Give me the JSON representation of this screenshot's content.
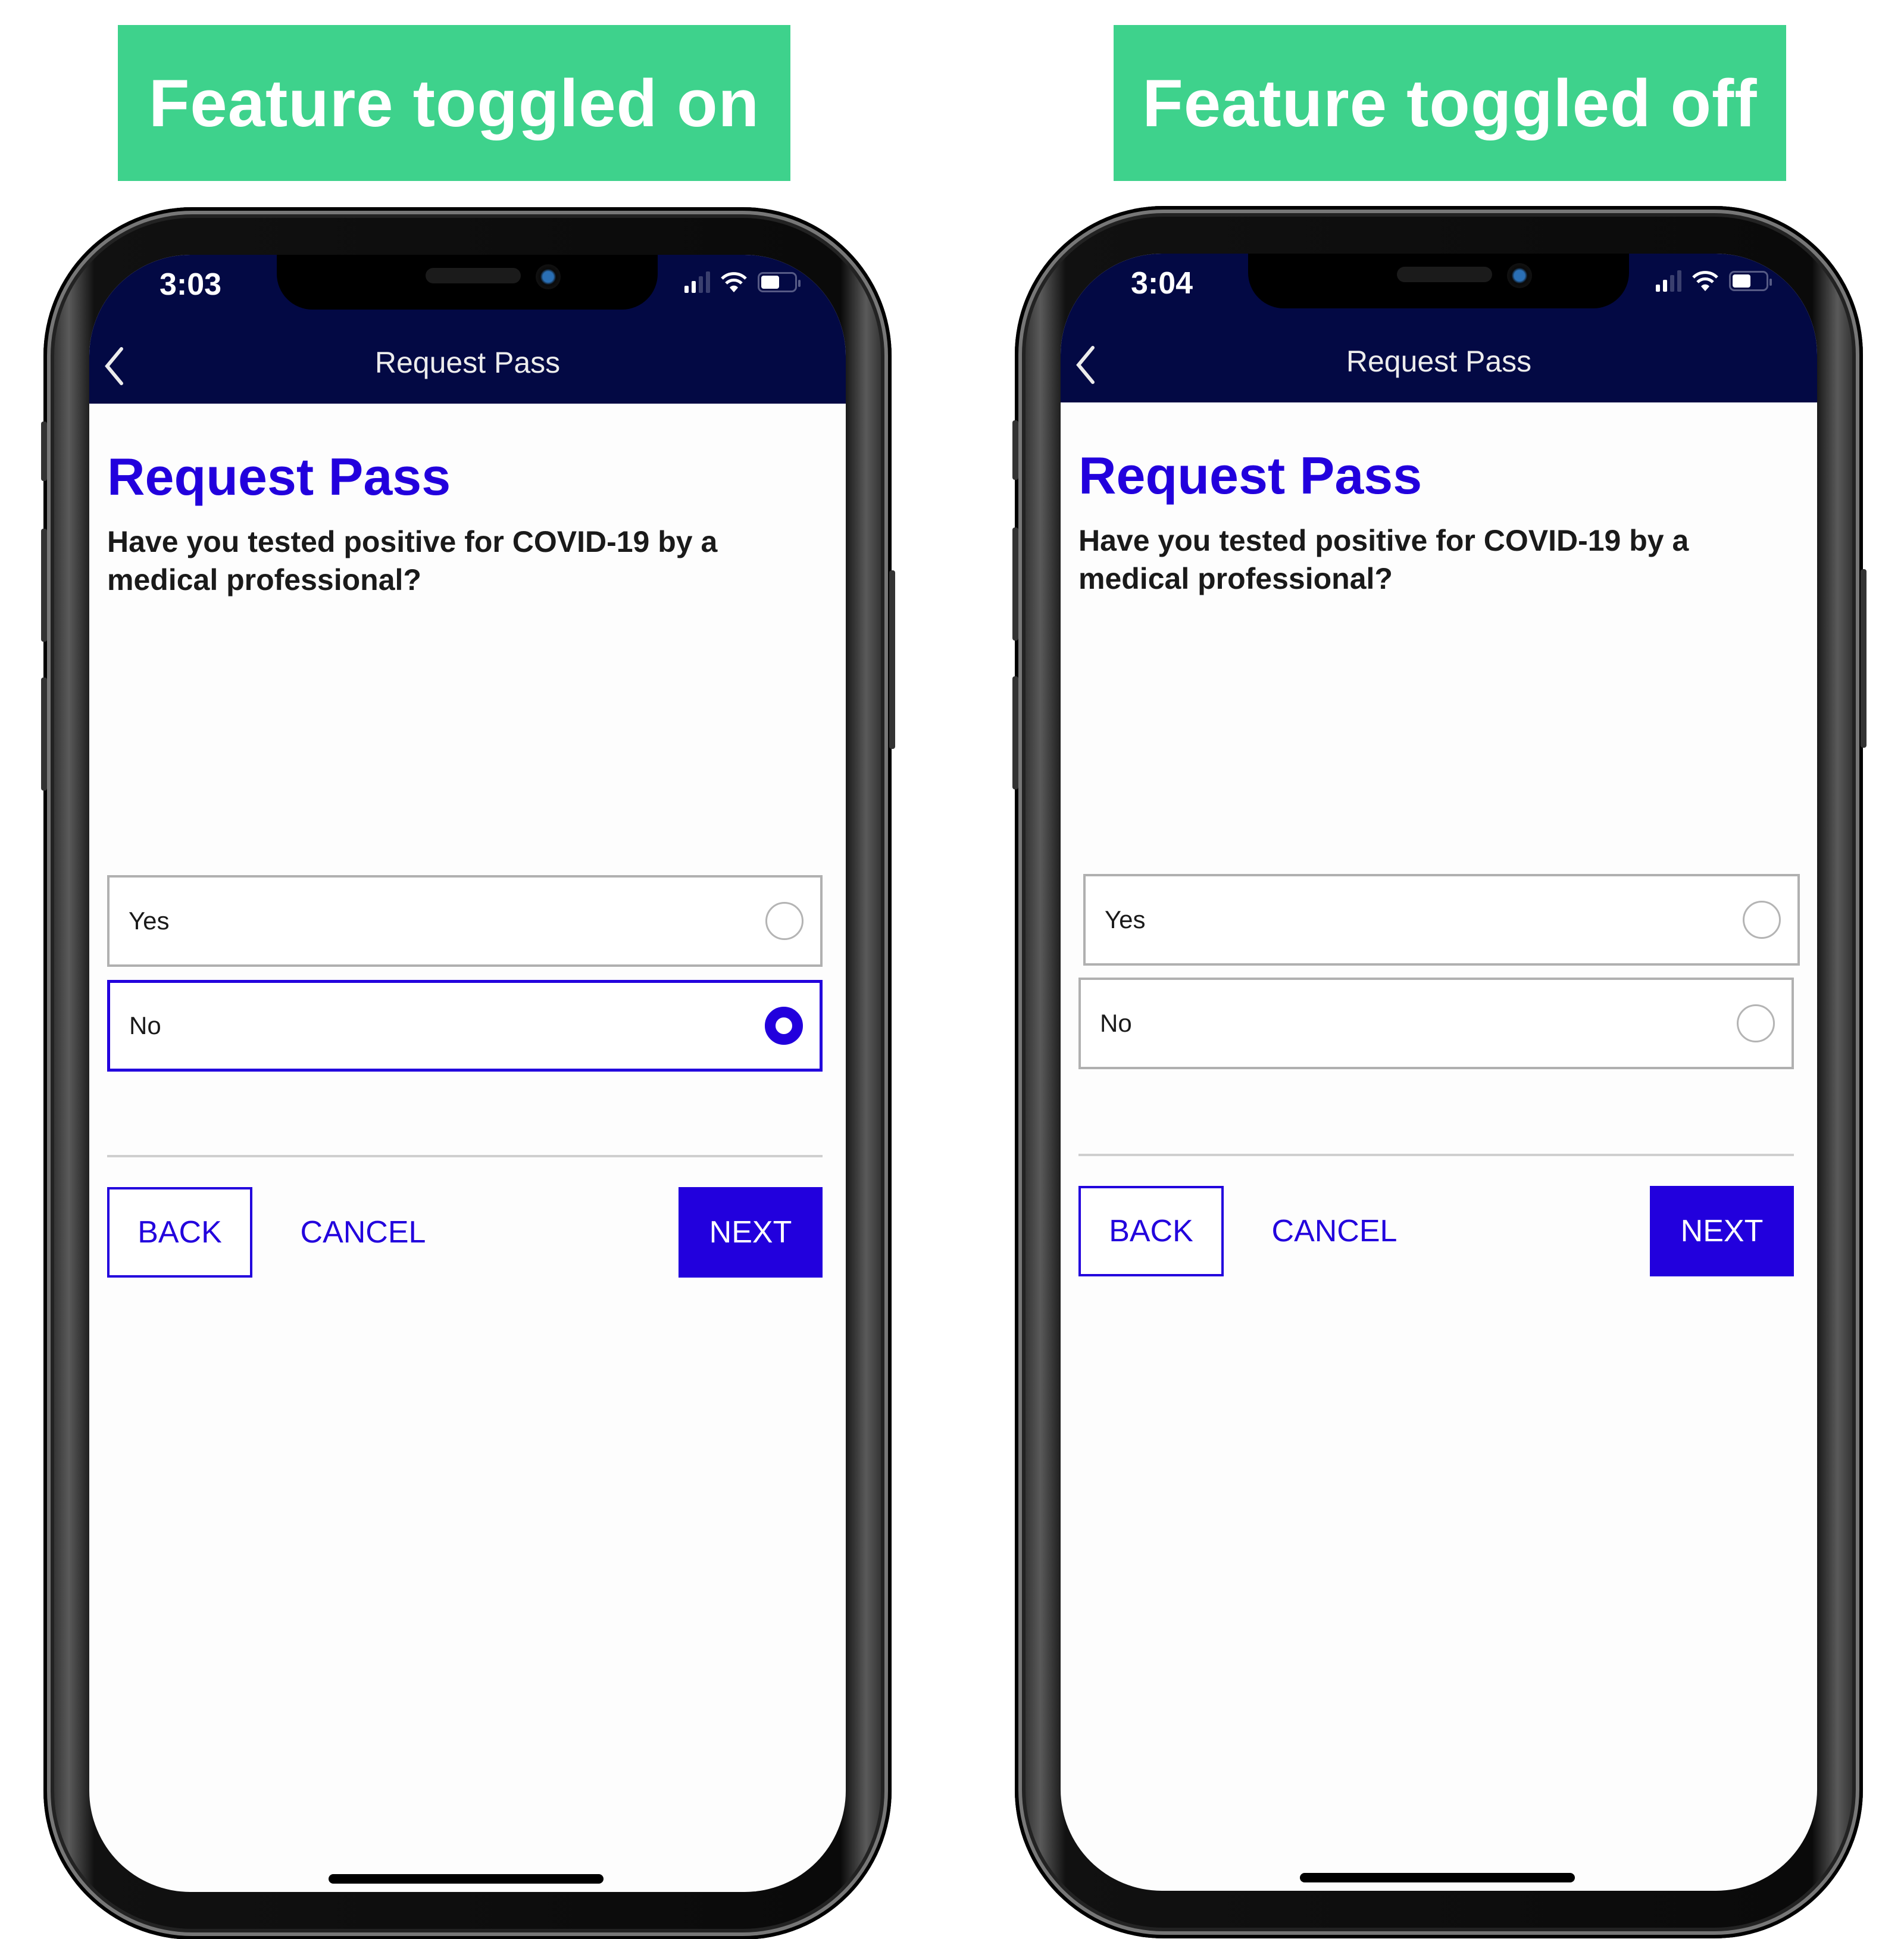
{
  "panels": [
    {
      "banner": "Feature toggled on",
      "status_bar": {
        "time": "3:03",
        "icons": [
          "signal-icon",
          "wifi-icon",
          "battery-icon"
        ]
      },
      "nav": {
        "back_icon": "chevron-left-icon",
        "title": "Request Pass"
      },
      "page_title": "Request Pass",
      "question": "Have you tested positive for COVID-19 by a medical professional?",
      "options": [
        {
          "label": "Yes",
          "selected": false
        },
        {
          "label": "No",
          "selected": true
        }
      ],
      "buttons": {
        "back": "BACK",
        "cancel": "CANCEL",
        "next": "NEXT"
      }
    },
    {
      "banner": "Feature toggled off",
      "status_bar": {
        "time": "3:04",
        "icons": [
          "signal-icon",
          "wifi-icon",
          "battery-icon"
        ]
      },
      "nav": {
        "back_icon": "chevron-left-icon",
        "title": "Request Pass"
      },
      "page_title": "Request Pass",
      "question": "Have you tested positive for COVID-19 by a medical professional?",
      "options": [
        {
          "label": "Yes",
          "selected": false
        },
        {
          "label": "No",
          "selected": false
        }
      ],
      "buttons": {
        "back": "BACK",
        "cancel": "CANCEL",
        "next": "NEXT"
      }
    }
  ],
  "colors": {
    "banner": "#3ed28c",
    "header": "#030944",
    "accent": "#2200dd",
    "border": "#b0b0b0"
  }
}
